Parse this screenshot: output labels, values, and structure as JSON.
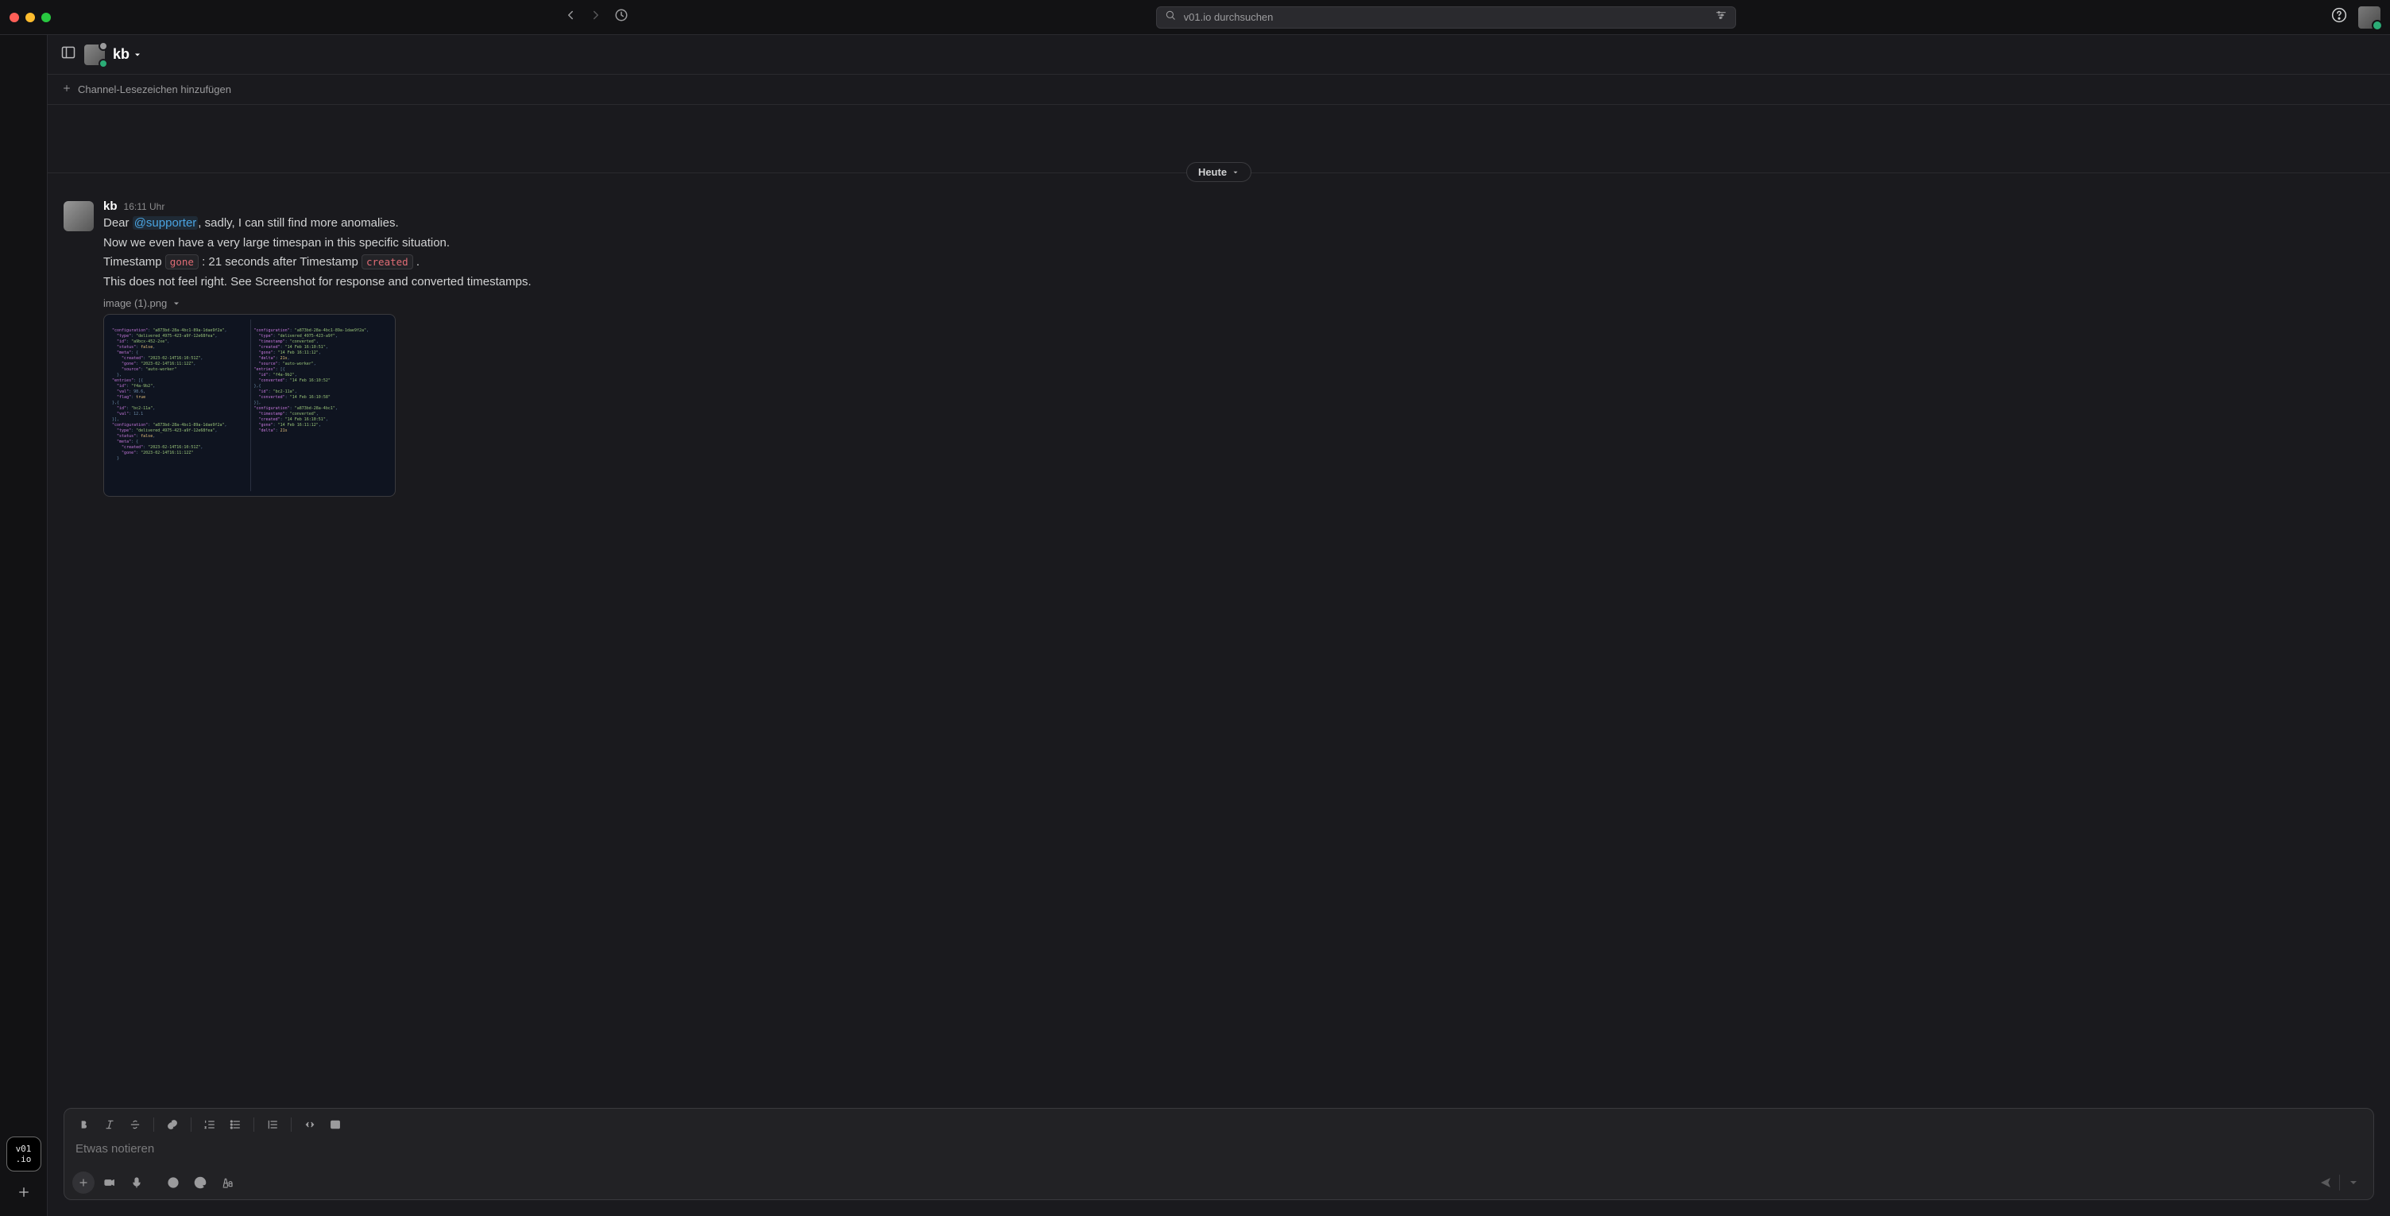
{
  "titlebar": {
    "search_placeholder": "v01.io durchsuchen"
  },
  "sidebar": {
    "workspace_line1": "v01",
    "workspace_line2": ".io"
  },
  "channel": {
    "name": "kb",
    "bookmark_label": "Channel-Lesezeichen hinzufügen"
  },
  "divider": {
    "label": "Heute"
  },
  "message": {
    "author": "kb",
    "time": "16:11 Uhr",
    "line1_prefix": "Dear ",
    "line1_mention": "@supporter",
    "line1_suffix": ", sadly, I can still find more anomalies.",
    "line2": "Now we even have a very large timespan in this specific situation.",
    "line3_a": "Timestamp ",
    "line3_code1": "gone",
    "line3_b": " : 21 seconds after Timestamp ",
    "line3_code2": "created",
    "line3_c": " .",
    "line4": "This does not feel right. See Screenshot for response and converted timestamps.",
    "attachment_name": "image (1).png"
  },
  "composer": {
    "placeholder": "Etwas notieren"
  }
}
